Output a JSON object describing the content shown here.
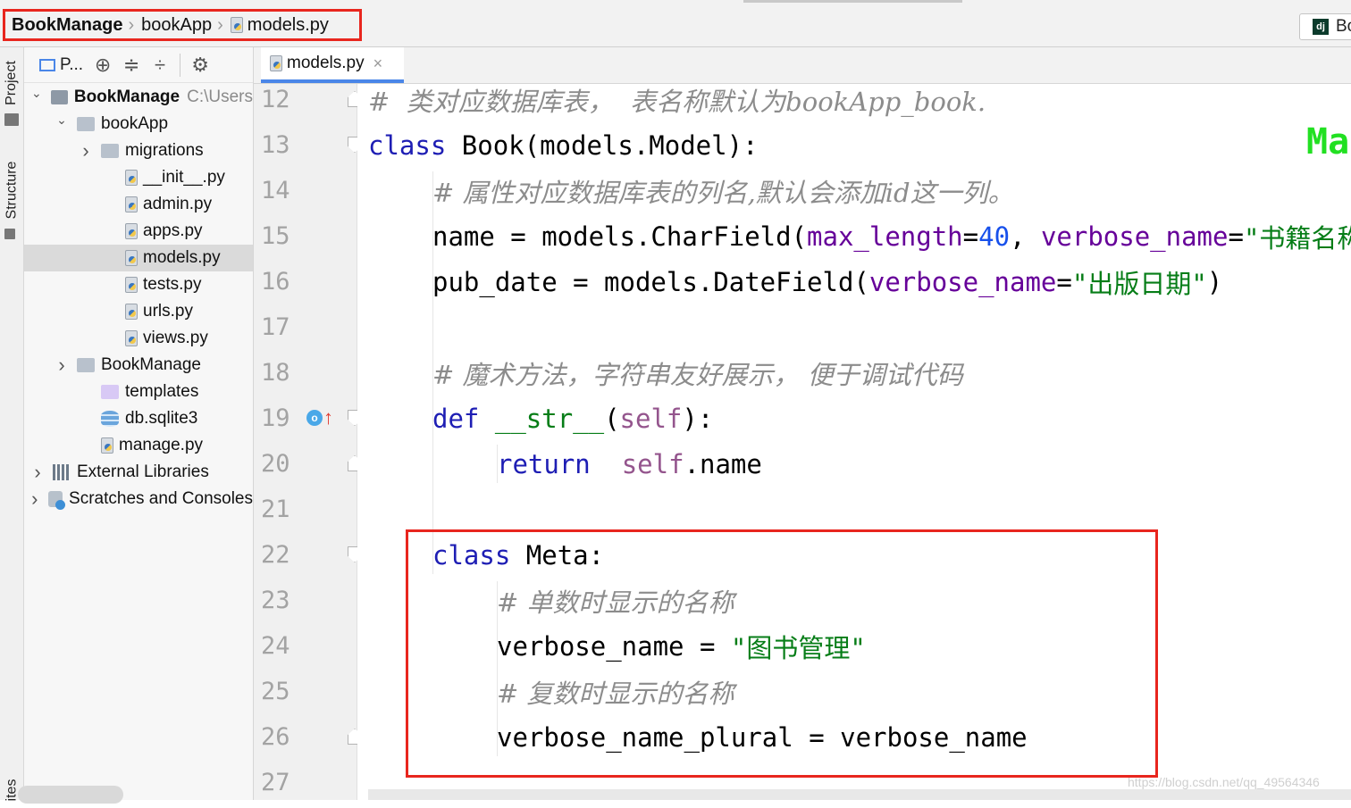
{
  "breadcrumb": [
    "BookManage",
    "bookApp",
    "models.py"
  ],
  "run_config": {
    "label": "Bo"
  },
  "side_tabs": {
    "project": "Project",
    "structure": "Structure",
    "bottom": "ites"
  },
  "project_toolbar": {
    "view_label": "P..."
  },
  "tree": [
    {
      "label": "BookManage",
      "suffix": "C:\\Users",
      "indent": 0,
      "chevron": "down",
      "icon": "folder-dark",
      "bold": true
    },
    {
      "label": "bookApp",
      "indent": 1,
      "chevron": "down",
      "icon": "folder"
    },
    {
      "label": "migrations",
      "indent": 2,
      "chevron": "right",
      "icon": "folder"
    },
    {
      "label": "__init__.py",
      "indent": 3,
      "icon": "py"
    },
    {
      "label": "admin.py",
      "indent": 3,
      "icon": "py"
    },
    {
      "label": "apps.py",
      "indent": 3,
      "icon": "py"
    },
    {
      "label": "models.py",
      "indent": 3,
      "icon": "py",
      "selected": true
    },
    {
      "label": "tests.py",
      "indent": 3,
      "icon": "py"
    },
    {
      "label": "urls.py",
      "indent": 3,
      "icon": "py"
    },
    {
      "label": "views.py",
      "indent": 3,
      "icon": "py"
    },
    {
      "label": "BookManage",
      "indent": 1,
      "chevron": "right",
      "icon": "folder"
    },
    {
      "label": "templates",
      "indent": 2,
      "icon": "folder-template"
    },
    {
      "label": "db.sqlite3",
      "indent": 2,
      "icon": "db"
    },
    {
      "label": "manage.py",
      "indent": 2,
      "icon": "py"
    },
    {
      "label": "External Libraries",
      "indent": 0,
      "chevron": "right",
      "icon": "library"
    },
    {
      "label": "Scratches and Consoles",
      "indent": 0,
      "chevron": "right",
      "icon": "scratch"
    }
  ],
  "editor_tab": {
    "label": "models.py",
    "close": "×"
  },
  "line_numbers": [
    "12",
    "13",
    "14",
    "15",
    "16",
    "17",
    "18",
    "19",
    "20",
    "21",
    "22",
    "23",
    "24",
    "25",
    "26",
    "27"
  ],
  "code_lines": [
    {
      "indent": 0,
      "tokens": [
        {
          "t": "#  类对应数据库表，  表名称默认为bookApp_book.",
          "c": "cmt"
        }
      ]
    },
    {
      "indent": 0,
      "tokens": [
        {
          "t": "class",
          "c": "kw"
        },
        {
          "t": " Book(models.Model):",
          "c": ""
        }
      ]
    },
    {
      "indent": 1,
      "tokens": [
        {
          "t": "# 属性对应数据库表的列名,默认会添加id这一列。",
          "c": "cmt"
        }
      ]
    },
    {
      "indent": 1,
      "tokens": [
        {
          "t": "name = models.CharField(",
          "c": ""
        },
        {
          "t": "max_length",
          "c": "param"
        },
        {
          "t": "=",
          "c": ""
        },
        {
          "t": "40",
          "c": "num"
        },
        {
          "t": ", ",
          "c": ""
        },
        {
          "t": "verbose_name",
          "c": "param"
        },
        {
          "t": "=",
          "c": ""
        },
        {
          "t": "\"书籍名称\"",
          "c": "str"
        },
        {
          "t": ")",
          "c": ""
        }
      ]
    },
    {
      "indent": 1,
      "tokens": [
        {
          "t": "pub_date = models.DateField(",
          "c": ""
        },
        {
          "t": "verbose_name",
          "c": "param"
        },
        {
          "t": "=",
          "c": ""
        },
        {
          "t": "\"出版日期\"",
          "c": "str"
        },
        {
          "t": ")",
          "c": ""
        }
      ]
    },
    {
      "indent": 0,
      "tokens": []
    },
    {
      "indent": 1,
      "tokens": [
        {
          "t": "# 魔术方法，字符串友好展示， 便于调试代码",
          "c": "cmt"
        }
      ]
    },
    {
      "indent": 1,
      "tokens": [
        {
          "t": "def",
          "c": "kw"
        },
        {
          "t": " ",
          "c": ""
        },
        {
          "t": "__str__",
          "c": "str"
        },
        {
          "t": "(",
          "c": ""
        },
        {
          "t": "self",
          "c": "slf"
        },
        {
          "t": "):",
          "c": ""
        }
      ]
    },
    {
      "indent": 2,
      "tokens": [
        {
          "t": "return",
          "c": "kw"
        },
        {
          "t": "  ",
          "c": ""
        },
        {
          "t": "self",
          "c": "slf"
        },
        {
          "t": ".name",
          "c": ""
        }
      ]
    },
    {
      "indent": 0,
      "tokens": []
    },
    {
      "indent": 1,
      "tokens": [
        {
          "t": "class",
          "c": "kw"
        },
        {
          "t": " Meta:",
          "c": ""
        }
      ]
    },
    {
      "indent": 2,
      "tokens": [
        {
          "t": "# 单数时显示的名称",
          "c": "cmt"
        }
      ]
    },
    {
      "indent": 2,
      "tokens": [
        {
          "t": "verbose_name = ",
          "c": ""
        },
        {
          "t": "\"图书管理\"",
          "c": "str"
        }
      ]
    },
    {
      "indent": 2,
      "tokens": [
        {
          "t": "# 复数时显示的名称",
          "c": "cmt"
        }
      ]
    },
    {
      "indent": 2,
      "tokens": [
        {
          "t": "verbose_name_plural = verbose_name",
          "c": ""
        }
      ]
    },
    {
      "indent": 0,
      "tokens": []
    }
  ],
  "overlay_marker": "Ma",
  "watermark": "https://blog.csdn.net/qq_49564346"
}
